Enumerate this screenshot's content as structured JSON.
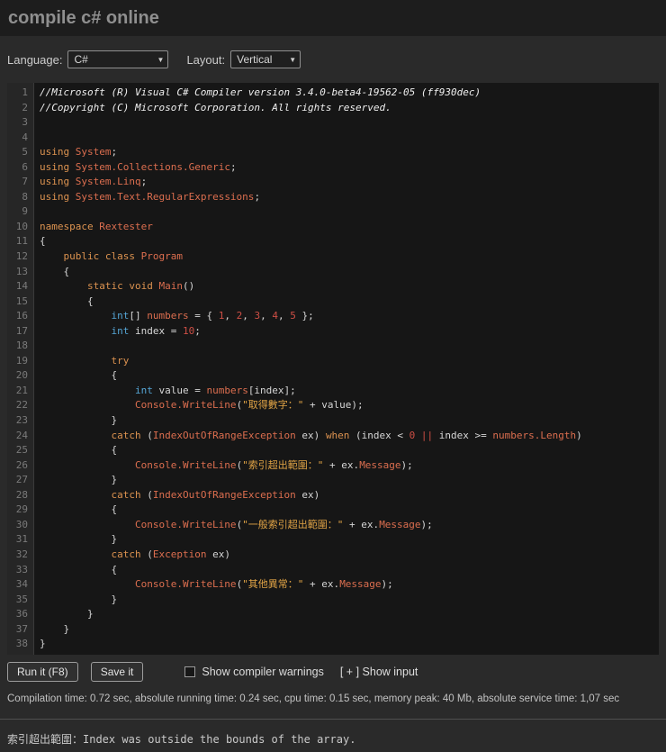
{
  "header": {
    "title": "compile c# online"
  },
  "toolbar": {
    "language_label": "Language:",
    "language_value": "C#",
    "layout_label": "Layout:",
    "layout_value": "Vertical"
  },
  "editor": {
    "lines": [
      [
        [
          "cm",
          "//Microsoft (R) Visual C# Compiler version 3.4.0-beta4-19562-05 (ff930dec)"
        ]
      ],
      [
        [
          "cm",
          "//Copyright (C) Microsoft Corporation. All rights reserved."
        ]
      ],
      [],
      [],
      [
        [
          "kw",
          "using"
        ],
        [
          "pl",
          " "
        ],
        [
          "ty",
          "System"
        ],
        [
          "pl",
          ";"
        ]
      ],
      [
        [
          "kw",
          "using"
        ],
        [
          "pl",
          " "
        ],
        [
          "ty",
          "System.Collections.Generic"
        ],
        [
          "pl",
          ";"
        ]
      ],
      [
        [
          "kw",
          "using"
        ],
        [
          "pl",
          " "
        ],
        [
          "ty",
          "System.Linq"
        ],
        [
          "pl",
          ";"
        ]
      ],
      [
        [
          "kw",
          "using"
        ],
        [
          "pl",
          " "
        ],
        [
          "ty",
          "System.Text.RegularExpressions"
        ],
        [
          "pl",
          ";"
        ]
      ],
      [],
      [
        [
          "kw",
          "namespace"
        ],
        [
          "pl",
          " "
        ],
        [
          "ty",
          "Rextester"
        ]
      ],
      [
        [
          "pl",
          "{"
        ]
      ],
      [
        [
          "pl",
          "    "
        ],
        [
          "kw",
          "public"
        ],
        [
          "pl",
          " "
        ],
        [
          "kw",
          "class"
        ],
        [
          "pl",
          " "
        ],
        [
          "ty",
          "Program"
        ]
      ],
      [
        [
          "pl",
          "    {"
        ]
      ],
      [
        [
          "pl",
          "        "
        ],
        [
          "kw",
          "static"
        ],
        [
          "pl",
          " "
        ],
        [
          "kw",
          "void"
        ],
        [
          "pl",
          " "
        ],
        [
          "ty",
          "Main"
        ],
        [
          "pl",
          "()"
        ]
      ],
      [
        [
          "pl",
          "        {"
        ]
      ],
      [
        [
          "pl",
          "            "
        ],
        [
          "bi",
          "int"
        ],
        [
          "pl",
          "[] "
        ],
        [
          "ty",
          "numbers"
        ],
        [
          "pl",
          " = { "
        ],
        [
          "num",
          "1"
        ],
        [
          "pl",
          ", "
        ],
        [
          "num",
          "2"
        ],
        [
          "pl",
          ", "
        ],
        [
          "num",
          "3"
        ],
        [
          "pl",
          ", "
        ],
        [
          "num",
          "4"
        ],
        [
          "pl",
          ", "
        ],
        [
          "num",
          "5"
        ],
        [
          "pl",
          " };"
        ]
      ],
      [
        [
          "pl",
          "            "
        ],
        [
          "bi",
          "int"
        ],
        [
          "pl",
          " index = "
        ],
        [
          "num",
          "10"
        ],
        [
          "pl",
          ";"
        ]
      ],
      [],
      [
        [
          "pl",
          "            "
        ],
        [
          "kw",
          "try"
        ]
      ],
      [
        [
          "pl",
          "            {"
        ]
      ],
      [
        [
          "pl",
          "                "
        ],
        [
          "bi",
          "int"
        ],
        [
          "pl",
          " value = "
        ],
        [
          "ty",
          "numbers"
        ],
        [
          "pl",
          "[index];"
        ]
      ],
      [
        [
          "pl",
          "                "
        ],
        [
          "ty",
          "Console.WriteLine"
        ],
        [
          "pl",
          "("
        ],
        [
          "str",
          "\"取得數字：\""
        ],
        [
          "pl",
          " + value);"
        ]
      ],
      [
        [
          "pl",
          "            }"
        ]
      ],
      [
        [
          "pl",
          "            "
        ],
        [
          "kw",
          "catch"
        ],
        [
          "pl",
          " ("
        ],
        [
          "ty",
          "IndexOutOfRangeException"
        ],
        [
          "pl",
          " ex) "
        ],
        [
          "kw",
          "when"
        ],
        [
          "pl",
          " (index < "
        ],
        [
          "num",
          "0"
        ],
        [
          "pl",
          " "
        ],
        [
          "op",
          "||"
        ],
        [
          "pl",
          " index >= "
        ],
        [
          "ty",
          "numbers.Length"
        ],
        [
          "pl",
          ")"
        ]
      ],
      [
        [
          "pl",
          "            {"
        ]
      ],
      [
        [
          "pl",
          "                "
        ],
        [
          "ty",
          "Console.WriteLine"
        ],
        [
          "pl",
          "("
        ],
        [
          "str",
          "\"索引超出範圍：\""
        ],
        [
          "pl",
          " + ex."
        ],
        [
          "ty",
          "Message"
        ],
        [
          "pl",
          ");"
        ]
      ],
      [
        [
          "pl",
          "            }"
        ]
      ],
      [
        [
          "pl",
          "            "
        ],
        [
          "kw",
          "catch"
        ],
        [
          "pl",
          " ("
        ],
        [
          "ty",
          "IndexOutOfRangeException"
        ],
        [
          "pl",
          " ex)"
        ]
      ],
      [
        [
          "pl",
          "            {"
        ]
      ],
      [
        [
          "pl",
          "                "
        ],
        [
          "ty",
          "Console.WriteLine"
        ],
        [
          "pl",
          "("
        ],
        [
          "str",
          "\"一般索引超出範圍：\""
        ],
        [
          "pl",
          " + ex."
        ],
        [
          "ty",
          "Message"
        ],
        [
          "pl",
          ");"
        ]
      ],
      [
        [
          "pl",
          "            }"
        ]
      ],
      [
        [
          "pl",
          "            "
        ],
        [
          "kw",
          "catch"
        ],
        [
          "pl",
          " ("
        ],
        [
          "ty",
          "Exception"
        ],
        [
          "pl",
          " ex)"
        ]
      ],
      [
        [
          "pl",
          "            {"
        ]
      ],
      [
        [
          "pl",
          "                "
        ],
        [
          "ty",
          "Console.WriteLine"
        ],
        [
          "pl",
          "("
        ],
        [
          "str",
          "\"其他異常：\""
        ],
        [
          "pl",
          " + ex."
        ],
        [
          "ty",
          "Message"
        ],
        [
          "pl",
          ");"
        ]
      ],
      [
        [
          "pl",
          "            }"
        ]
      ],
      [
        [
          "pl",
          "        }"
        ]
      ],
      [
        [
          "pl",
          "    }"
        ]
      ],
      [
        [
          "pl",
          "}"
        ]
      ]
    ]
  },
  "actions": {
    "run_button": "Run it (F8)",
    "save_button": "Save it",
    "warnings_label": "Show compiler warnings",
    "warnings_checked": false,
    "show_input_label": "[ + ] Show input"
  },
  "status": {
    "text": "Compilation time: 0.72 sec, absolute running time: 0.24 sec, cpu time: 0.15 sec, memory peak: 40 Mb, absolute service time: 1,07 sec"
  },
  "output": {
    "text": "索引超出範圍：Index was outside the bounds of the array."
  },
  "colors": {
    "keyword": "#dd9350",
    "type": "#dc6e4f",
    "builtin": "#55a5d5",
    "number": "#cf4f45",
    "string": "#e0a345",
    "comment": "#efefef",
    "operator": "#cf4f45",
    "plain": "#d6d6d6",
    "editor_background": "#161616",
    "page_background": "#2a2a2a"
  }
}
